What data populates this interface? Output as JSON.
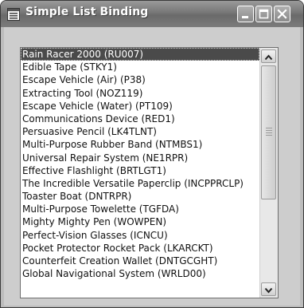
{
  "window": {
    "title": "Simple List Binding",
    "controls": [
      "minimize",
      "maximize",
      "close"
    ]
  },
  "listbox": {
    "selected_index": 0,
    "items": [
      "Rain Racer 2000 (RU007)",
      "Edible Tape (STKY1)",
      "Escape Vehicle (Air) (P38)",
      "Extracting Tool (NOZ119)",
      "Escape Vehicle (Water) (PT109)",
      "Communications Device (RED1)",
      "Persuasive Pencil (LK4TLNT)",
      "Multi-Purpose Rubber Band (NTMBS1)",
      "Universal Repair System (NE1RPR)",
      "Effective Flashlight (BRTLGT1)",
      "The Incredible Versatile Paperclip (INCPPRCLP)",
      "Toaster Boat (DNTRPR)",
      "Multi-Purpose Towelette (TGFDA)",
      "Mighty Mighty Pen (WOWPEN)",
      "Perfect-Vision Glasses (ICNCU)",
      "Pocket Protector Rocket Pack (LKARCKT)",
      "Counterfeit Creation Wallet (DNTGCGHT)",
      "Global Navigational System (WRLD00)"
    ]
  },
  "icons": {
    "app": "list-window-icon",
    "minimize": "minimize-icon",
    "maximize": "maximize-icon",
    "close": "close-icon",
    "scroll_up": "scroll-up-arrow-icon",
    "scroll_down": "scroll-down-arrow-icon"
  },
  "colors": {
    "titlebar": "#7a7a7a",
    "selection": "#4a4a4a",
    "client": "#cdcdcd"
  }
}
